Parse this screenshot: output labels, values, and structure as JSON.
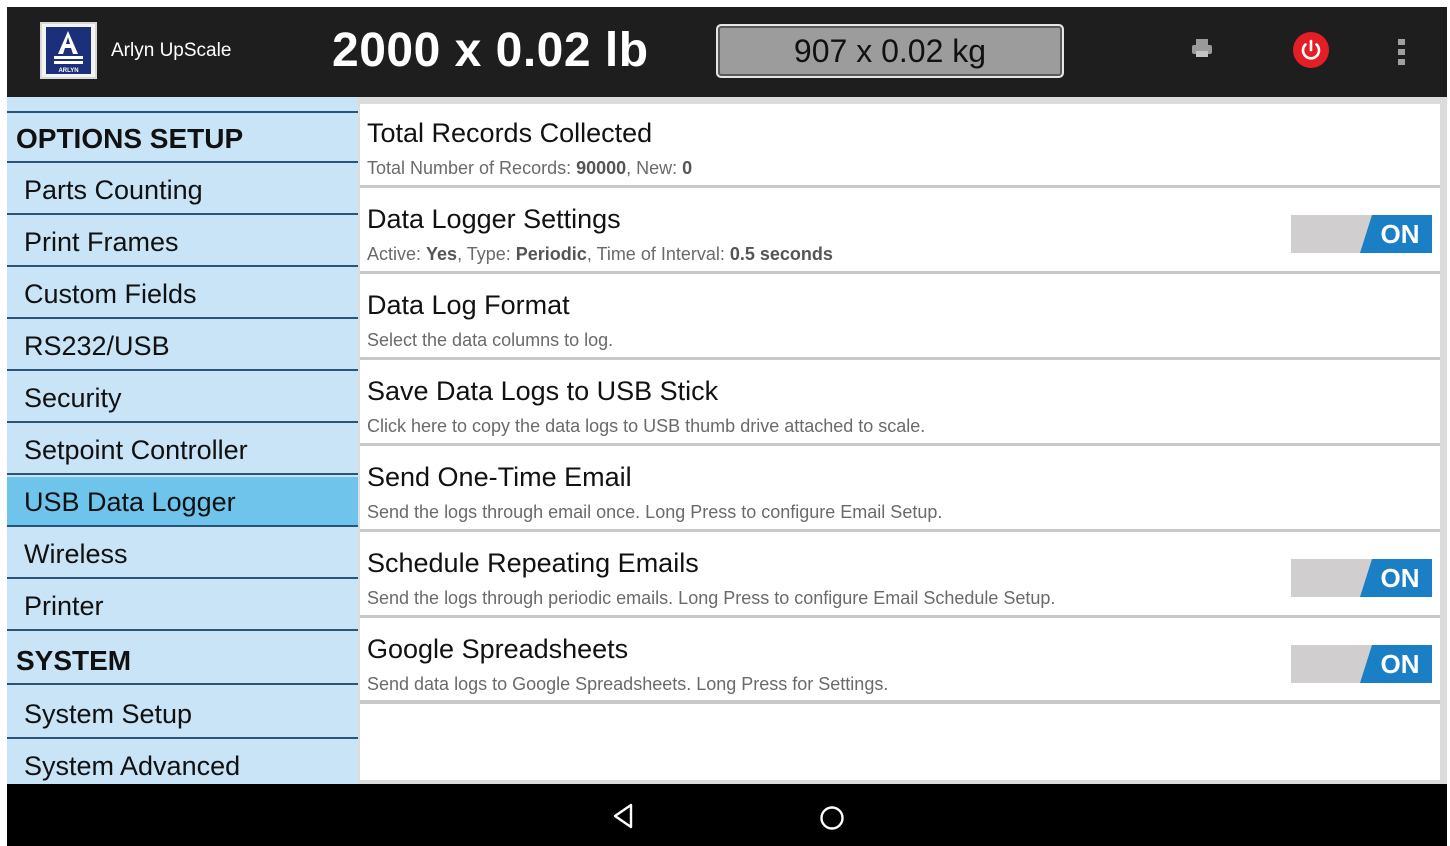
{
  "app": {
    "name": "Arlyn UpScale",
    "primary_weight": "2000 x 0.02 lb",
    "secondary_weight": "907 x 0.02 kg",
    "logo_text": "ARLYN"
  },
  "colors": {
    "appbar": "#1e1e1e",
    "sidebar": "#c9e3f7",
    "sidebar_active": "#6fc4ec",
    "toggle_on": "#1a7fc4",
    "power": "#e41e26"
  },
  "icons": {
    "print": "print-icon",
    "power": "power-icon",
    "menu": "overflow-menu-icon",
    "back": "back-icon",
    "home": "home-icon"
  },
  "sidebar": {
    "sections": [
      {
        "label": "OPTIONS SETUP",
        "header": true
      },
      {
        "label": "Parts Counting"
      },
      {
        "label": "Print Frames"
      },
      {
        "label": "Custom Fields"
      },
      {
        "label": "RS232/USB"
      },
      {
        "label": "Security"
      },
      {
        "label": "Setpoint Controller"
      },
      {
        "label": "USB Data Logger",
        "active": true
      },
      {
        "label": "Wireless"
      },
      {
        "label": "Printer"
      },
      {
        "label": "SYSTEM",
        "header": true
      },
      {
        "label": "System Setup"
      },
      {
        "label": "System Advanced"
      }
    ]
  },
  "prefs": [
    {
      "title": "Total Records Collected",
      "summary_parts": [
        "Total Number of Records: ",
        "90000",
        ", New: ",
        "0"
      ]
    },
    {
      "title": "Data Logger Settings",
      "summary_parts": [
        "Active: ",
        "Yes",
        ", Type: ",
        "Periodic",
        ", Time of Interval: ",
        "0.5 seconds"
      ],
      "toggle": "ON"
    },
    {
      "title": "Data Log Format",
      "summary": "Select the data columns to log."
    },
    {
      "title": "Save Data Logs to USB Stick",
      "summary": "Click here to copy the data logs to USB thumb drive attached to scale."
    },
    {
      "title": "Send One-Time Email",
      "summary": "Send the logs through email once. Long Press to configure Email Setup."
    },
    {
      "title": "Schedule Repeating Emails",
      "summary": "Send the logs through periodic emails. Long Press to configure Email Schedule Setup.",
      "toggle": "ON"
    },
    {
      "title": "Google Spreadsheets",
      "summary": "Send data logs to Google Spreadsheets. Long Press for Settings.",
      "toggle": "ON"
    }
  ]
}
